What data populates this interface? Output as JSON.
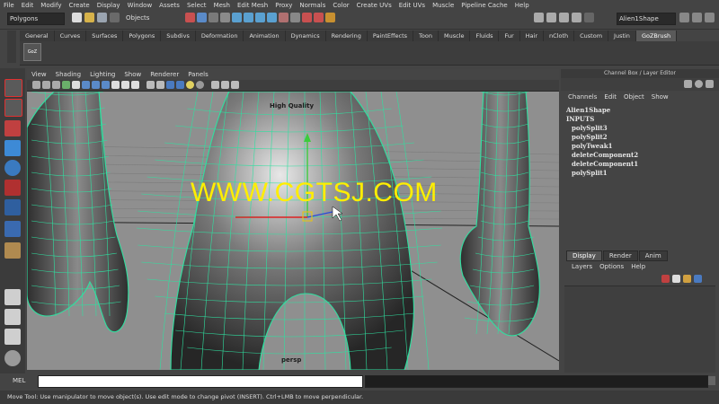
{
  "menus": [
    "File",
    "Edit",
    "Modify",
    "Create",
    "Display",
    "Window",
    "Assets",
    "Select",
    "Mesh",
    "Edit Mesh",
    "Proxy",
    "Normals",
    "Color",
    "Create UVs",
    "Edit UVs",
    "Muscle",
    "Pipeline Cache",
    "Help"
  ],
  "status_line": {
    "mode": "Polygons",
    "object_label": "Objects",
    "shape_name": "Alien1Shape"
  },
  "shelf": {
    "tabs": [
      "General",
      "Curves",
      "Surfaces",
      "Polygons",
      "Subdivs",
      "Deformation",
      "Animation",
      "Dynamics",
      "Rendering",
      "PaintEffects",
      "Toon",
      "Muscle",
      "Fluids",
      "Fur",
      "Hair",
      "nCloth",
      "Custom",
      "Justin",
      "GoZBrush"
    ],
    "active_tab": "GoZBrush",
    "goz_label": "GoZ"
  },
  "panel": {
    "menus": [
      "View",
      "Shading",
      "Lighting",
      "Show",
      "Renderer",
      "Panels"
    ]
  },
  "viewport": {
    "quality_label": "High Quality",
    "camera_label": "persp",
    "watermark": "WWW.CGTSJ.COM",
    "wire_color": "#2fe0a0",
    "background_color": "#8f8f8f"
  },
  "channel_box": {
    "title": "Channel Box / Layer Editor",
    "menus": [
      "Channels",
      "Edit",
      "Object",
      "Show"
    ],
    "object_name": "Alien1Shape",
    "inputs_label": "INPUTS",
    "inputs": [
      "polySplit3",
      "polySplit2",
      "polyTweak1",
      "deleteComponent2",
      "deleteComponent1",
      "polySplit1"
    ]
  },
  "layer_editor": {
    "tabs": [
      "Display",
      "Render",
      "Anim"
    ],
    "active_tab": "Display",
    "menus": [
      "Layers",
      "Options",
      "Help"
    ]
  },
  "command_line": {
    "label": "MEL"
  },
  "help_line": "Move Tool: Use manipulator to move object(s). Use edit mode to change pivot (INSERT). Ctrl+LMB to move perpendicular."
}
